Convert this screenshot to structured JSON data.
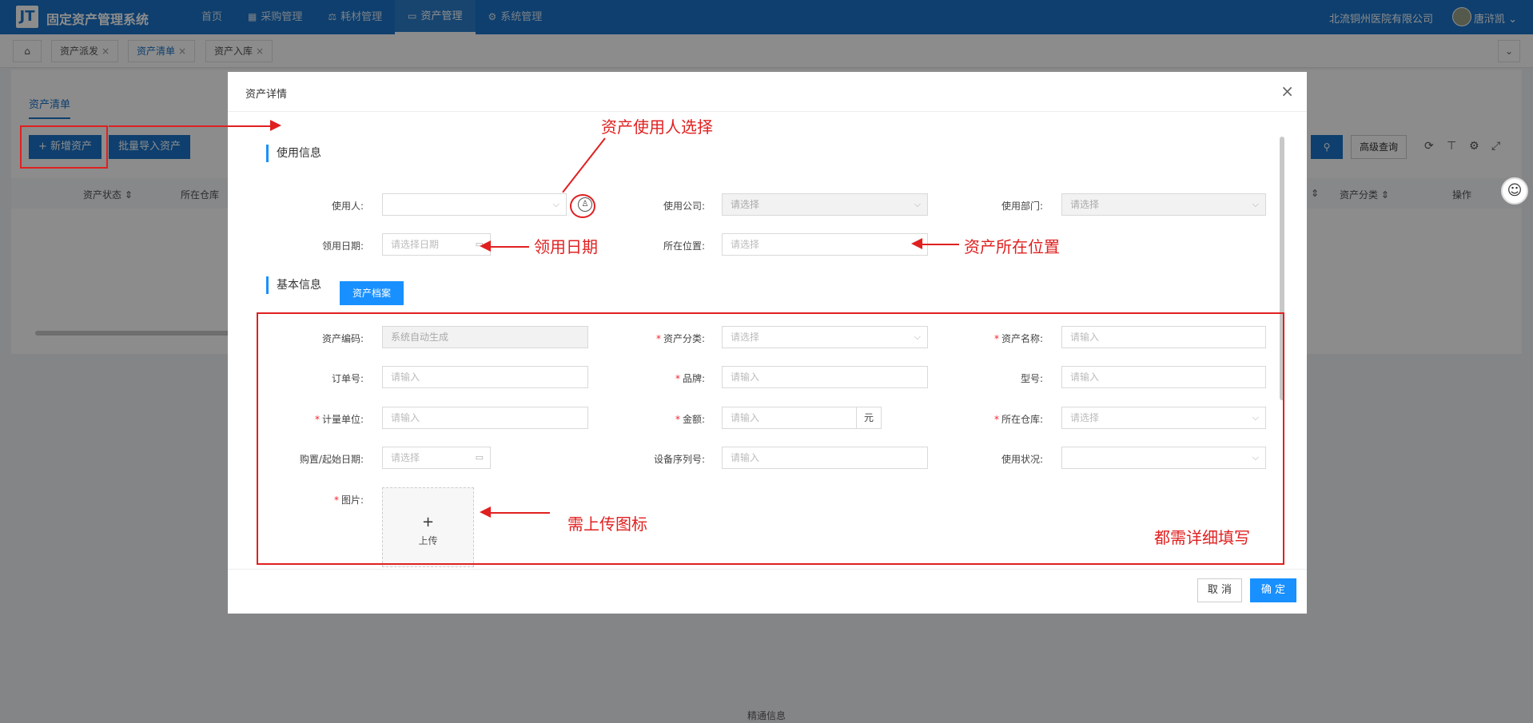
{
  "app": {
    "logo_text": "JT",
    "title": "固定资产管理系统"
  },
  "nav": [
    {
      "label": "首页",
      "icon": ""
    },
    {
      "label": "采购管理",
      "icon": "▦"
    },
    {
      "label": "耗材管理",
      "icon": "⚖"
    },
    {
      "label": "资产管理",
      "icon": "▭"
    },
    {
      "label": "系统管理",
      "icon": "⚙"
    }
  ],
  "header": {
    "company": "北流铜州医院有限公司",
    "user": "唐浒凯 ⌄"
  },
  "tabs": [
    {
      "label": "资产派发",
      "close": "×"
    },
    {
      "label": "资产清单",
      "close": "×"
    },
    {
      "label": "资产入库",
      "close": "×"
    }
  ],
  "tab_icons": {
    "home": "⌂",
    "more": "⌄"
  },
  "background": {
    "page_tab": "资产清单",
    "add_button": "+ 新增资产",
    "import_button": "批量导入资产",
    "advanced_search": "高级查询",
    "columns": [
      "资产状态 ⇕",
      "所在仓库",
      "⇕",
      "资产分类 ⇕",
      "操作"
    ],
    "tool_icons": [
      "⟳",
      "⊤",
      "⚙",
      "⤢"
    ],
    "search_icon": "⚲"
  },
  "footer": {
    "text": "精通信息"
  },
  "modal": {
    "title": "资产详情",
    "close": "×",
    "usage_section": "使用信息",
    "basic_section": "基本信息",
    "archive_button": "资产档案",
    "fields": {
      "user": {
        "label": "使用人:",
        "value": ""
      },
      "company": {
        "label": "使用公司:",
        "placeholder": "请选择"
      },
      "department": {
        "label": "使用部门:",
        "placeholder": "请选择"
      },
      "receive_date": {
        "label": "领用日期:",
        "placeholder": "请选择日期"
      },
      "location": {
        "label": "所在位置:",
        "placeholder": "请选择"
      },
      "asset_code": {
        "label": "资产编码:",
        "placeholder": "系统自动生成"
      },
      "asset_category": {
        "label": "资产分类:",
        "placeholder": "请选择"
      },
      "asset_name": {
        "label": "资产名称:",
        "placeholder": "请输入"
      },
      "order_no": {
        "label": "订单号:",
        "placeholder": "请输入"
      },
      "brand": {
        "label": "品牌:",
        "placeholder": "请输入"
      },
      "model": {
        "label": "型号:",
        "placeholder": "请输入"
      },
      "unit": {
        "label": "计量单位:",
        "placeholder": "请输入"
      },
      "amount": {
        "label": "金额:",
        "placeholder": "请输入",
        "suffix": "元"
      },
      "warehouse": {
        "label": "所在仓库:",
        "placeholder": "请选择"
      },
      "purchase_date": {
        "label": "购置/起始日期:",
        "placeholder": "请选择"
      },
      "serial_no": {
        "label": "设备序列号:",
        "placeholder": "请输入"
      },
      "usage_status": {
        "label": "使用状况:",
        "value": ""
      },
      "image": {
        "label": "图片:"
      }
    },
    "upload": {
      "plus": "+",
      "text": "上传"
    },
    "cancel": "取 消",
    "confirm": "确 定"
  },
  "annotations": {
    "user_select": "资产使用人选择",
    "receive_date": "领用日期",
    "location": "资产所在位置",
    "upload_icon": "需上传图标",
    "fill_all": "都需详细填写"
  },
  "icons": {
    "user": "user-icon",
    "calendar": "calendar-icon",
    "caret": "chevron-down-icon"
  },
  "colors": {
    "primary": "#1890ff",
    "topbar": "#1a73c9",
    "annotation": "#e02020"
  }
}
